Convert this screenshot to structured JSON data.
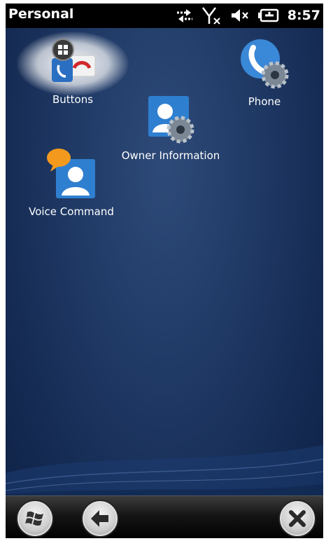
{
  "statusbar": {
    "title": "Personal",
    "time": "8:57",
    "icons": [
      "data-sync-icon",
      "no-signal-icon",
      "speaker-muted-icon",
      "battery-charging-icon"
    ]
  },
  "apps": [
    {
      "label": "Buttons",
      "icon": "buttons-icon",
      "selected": true
    },
    {
      "label": "Phone",
      "icon": "phone-settings-icon"
    },
    {
      "label": "Owner Information",
      "icon": "owner-information-icon"
    },
    {
      "label": "Voice Command",
      "icon": "voice-command-icon"
    }
  ],
  "bottombar": {
    "buttons": [
      "windows-start-icon",
      "back-arrow-icon",
      "close-icon"
    ]
  },
  "colors": {
    "background": "#1f3763",
    "statusbar": "#000000",
    "label": "#ffffff"
  }
}
